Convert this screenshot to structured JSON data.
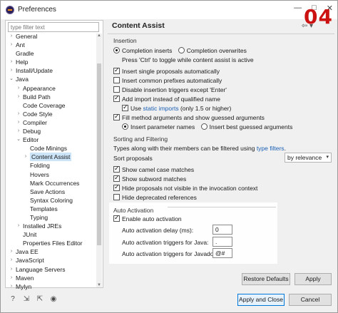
{
  "window": {
    "title": "Preferences",
    "badge": "04",
    "minimize": "—",
    "maximize": "□",
    "close": "✕"
  },
  "filter": {
    "placeholder": "type filter text"
  },
  "tree": [
    {
      "label": "General",
      "indent": 0,
      "twisty": ">"
    },
    {
      "label": "Ant",
      "indent": 0,
      "twisty": ">"
    },
    {
      "label": "Gradle",
      "indent": 0,
      "twisty": ""
    },
    {
      "label": "Help",
      "indent": 0,
      "twisty": ">"
    },
    {
      "label": "Install/Update",
      "indent": 0,
      "twisty": ">"
    },
    {
      "label": "Java",
      "indent": 0,
      "twisty": "v"
    },
    {
      "label": "Appearance",
      "indent": 1,
      "twisty": ">"
    },
    {
      "label": "Build Path",
      "indent": 1,
      "twisty": ">"
    },
    {
      "label": "Code Coverage",
      "indent": 1,
      "twisty": ""
    },
    {
      "label": "Code Style",
      "indent": 1,
      "twisty": ">"
    },
    {
      "label": "Compiler",
      "indent": 1,
      "twisty": ">"
    },
    {
      "label": "Debug",
      "indent": 1,
      "twisty": ">"
    },
    {
      "label": "Editor",
      "indent": 1,
      "twisty": "v"
    },
    {
      "label": "Code Minings",
      "indent": 2,
      "twisty": ""
    },
    {
      "label": "Content Assist",
      "indent": 2,
      "twisty": ">",
      "selected": true
    },
    {
      "label": "Folding",
      "indent": 2,
      "twisty": ""
    },
    {
      "label": "Hovers",
      "indent": 2,
      "twisty": ""
    },
    {
      "label": "Mark Occurrences",
      "indent": 2,
      "twisty": ""
    },
    {
      "label": "Save Actions",
      "indent": 2,
      "twisty": ""
    },
    {
      "label": "Syntax Coloring",
      "indent": 2,
      "twisty": ""
    },
    {
      "label": "Templates",
      "indent": 2,
      "twisty": ""
    },
    {
      "label": "Typing",
      "indent": 2,
      "twisty": ""
    },
    {
      "label": "Installed JREs",
      "indent": 1,
      "twisty": ">"
    },
    {
      "label": "JUnit",
      "indent": 1,
      "twisty": ""
    },
    {
      "label": "Properties Files Editor",
      "indent": 1,
      "twisty": ""
    },
    {
      "label": "Java EE",
      "indent": 0,
      "twisty": ">"
    },
    {
      "label": "JavaScript",
      "indent": 0,
      "twisty": ">"
    },
    {
      "label": "Language Servers",
      "indent": 0,
      "twisty": ">"
    },
    {
      "label": "Maven",
      "indent": 0,
      "twisty": ">"
    },
    {
      "label": "Mylyn",
      "indent": 0,
      "twisty": ">"
    }
  ],
  "pane": {
    "title": "Content Assist",
    "insertion": {
      "heading": "Insertion",
      "completion_inserts": "Completion inserts",
      "completion_overwrites": "Completion overwrites",
      "toggle_hint": "Press 'Ctrl' to toggle while content assist is active",
      "single_proposals": "Insert single proposals automatically",
      "common_prefixes": "Insert common prefixes automatically",
      "disable_triggers": "Disable insertion triggers except 'Enter'",
      "add_import": "Add import instead of qualified name",
      "use": "Use",
      "static_imports": "static imports",
      "static_suffix": "(only 1.5 or higher)",
      "fill_args": "Fill method arguments and show guessed arguments",
      "insert_param_names": "Insert parameter names",
      "insert_best_guessed": "Insert best guessed arguments"
    },
    "sorting": {
      "heading": "Sorting and Filtering",
      "types_text": "Types along with their members can be filtered using",
      "type_filters": "type filters",
      "sort_proposals": "Sort proposals",
      "sort_value": "by relevance",
      "camel_case": "Show camel case matches",
      "subword": "Show subword matches",
      "hide_not_visible": "Hide proposals not visible in the invocation context",
      "hide_deprecated": "Hide deprecated references"
    },
    "auto": {
      "heading": "Auto Activation",
      "enable": "Enable auto activation",
      "delay_label": "Auto activation delay (ms):",
      "delay_value": "0",
      "java_label": "Auto activation triggers for Java:",
      "java_value": ".",
      "javadoc_label": "Auto activation triggers for Javadoc:",
      "javadoc_value": "@#"
    },
    "restore_defaults": "Restore Defaults",
    "apply": "Apply"
  },
  "footer": {
    "apply_close": "Apply and Close",
    "cancel": "Cancel"
  },
  "colors": {
    "link": "#1a5fb4",
    "badge": "#cc1111",
    "selection": "#cce4f7"
  },
  "icons": [
    "help-icon",
    "import-icon",
    "export-icon",
    "settings-icon"
  ]
}
